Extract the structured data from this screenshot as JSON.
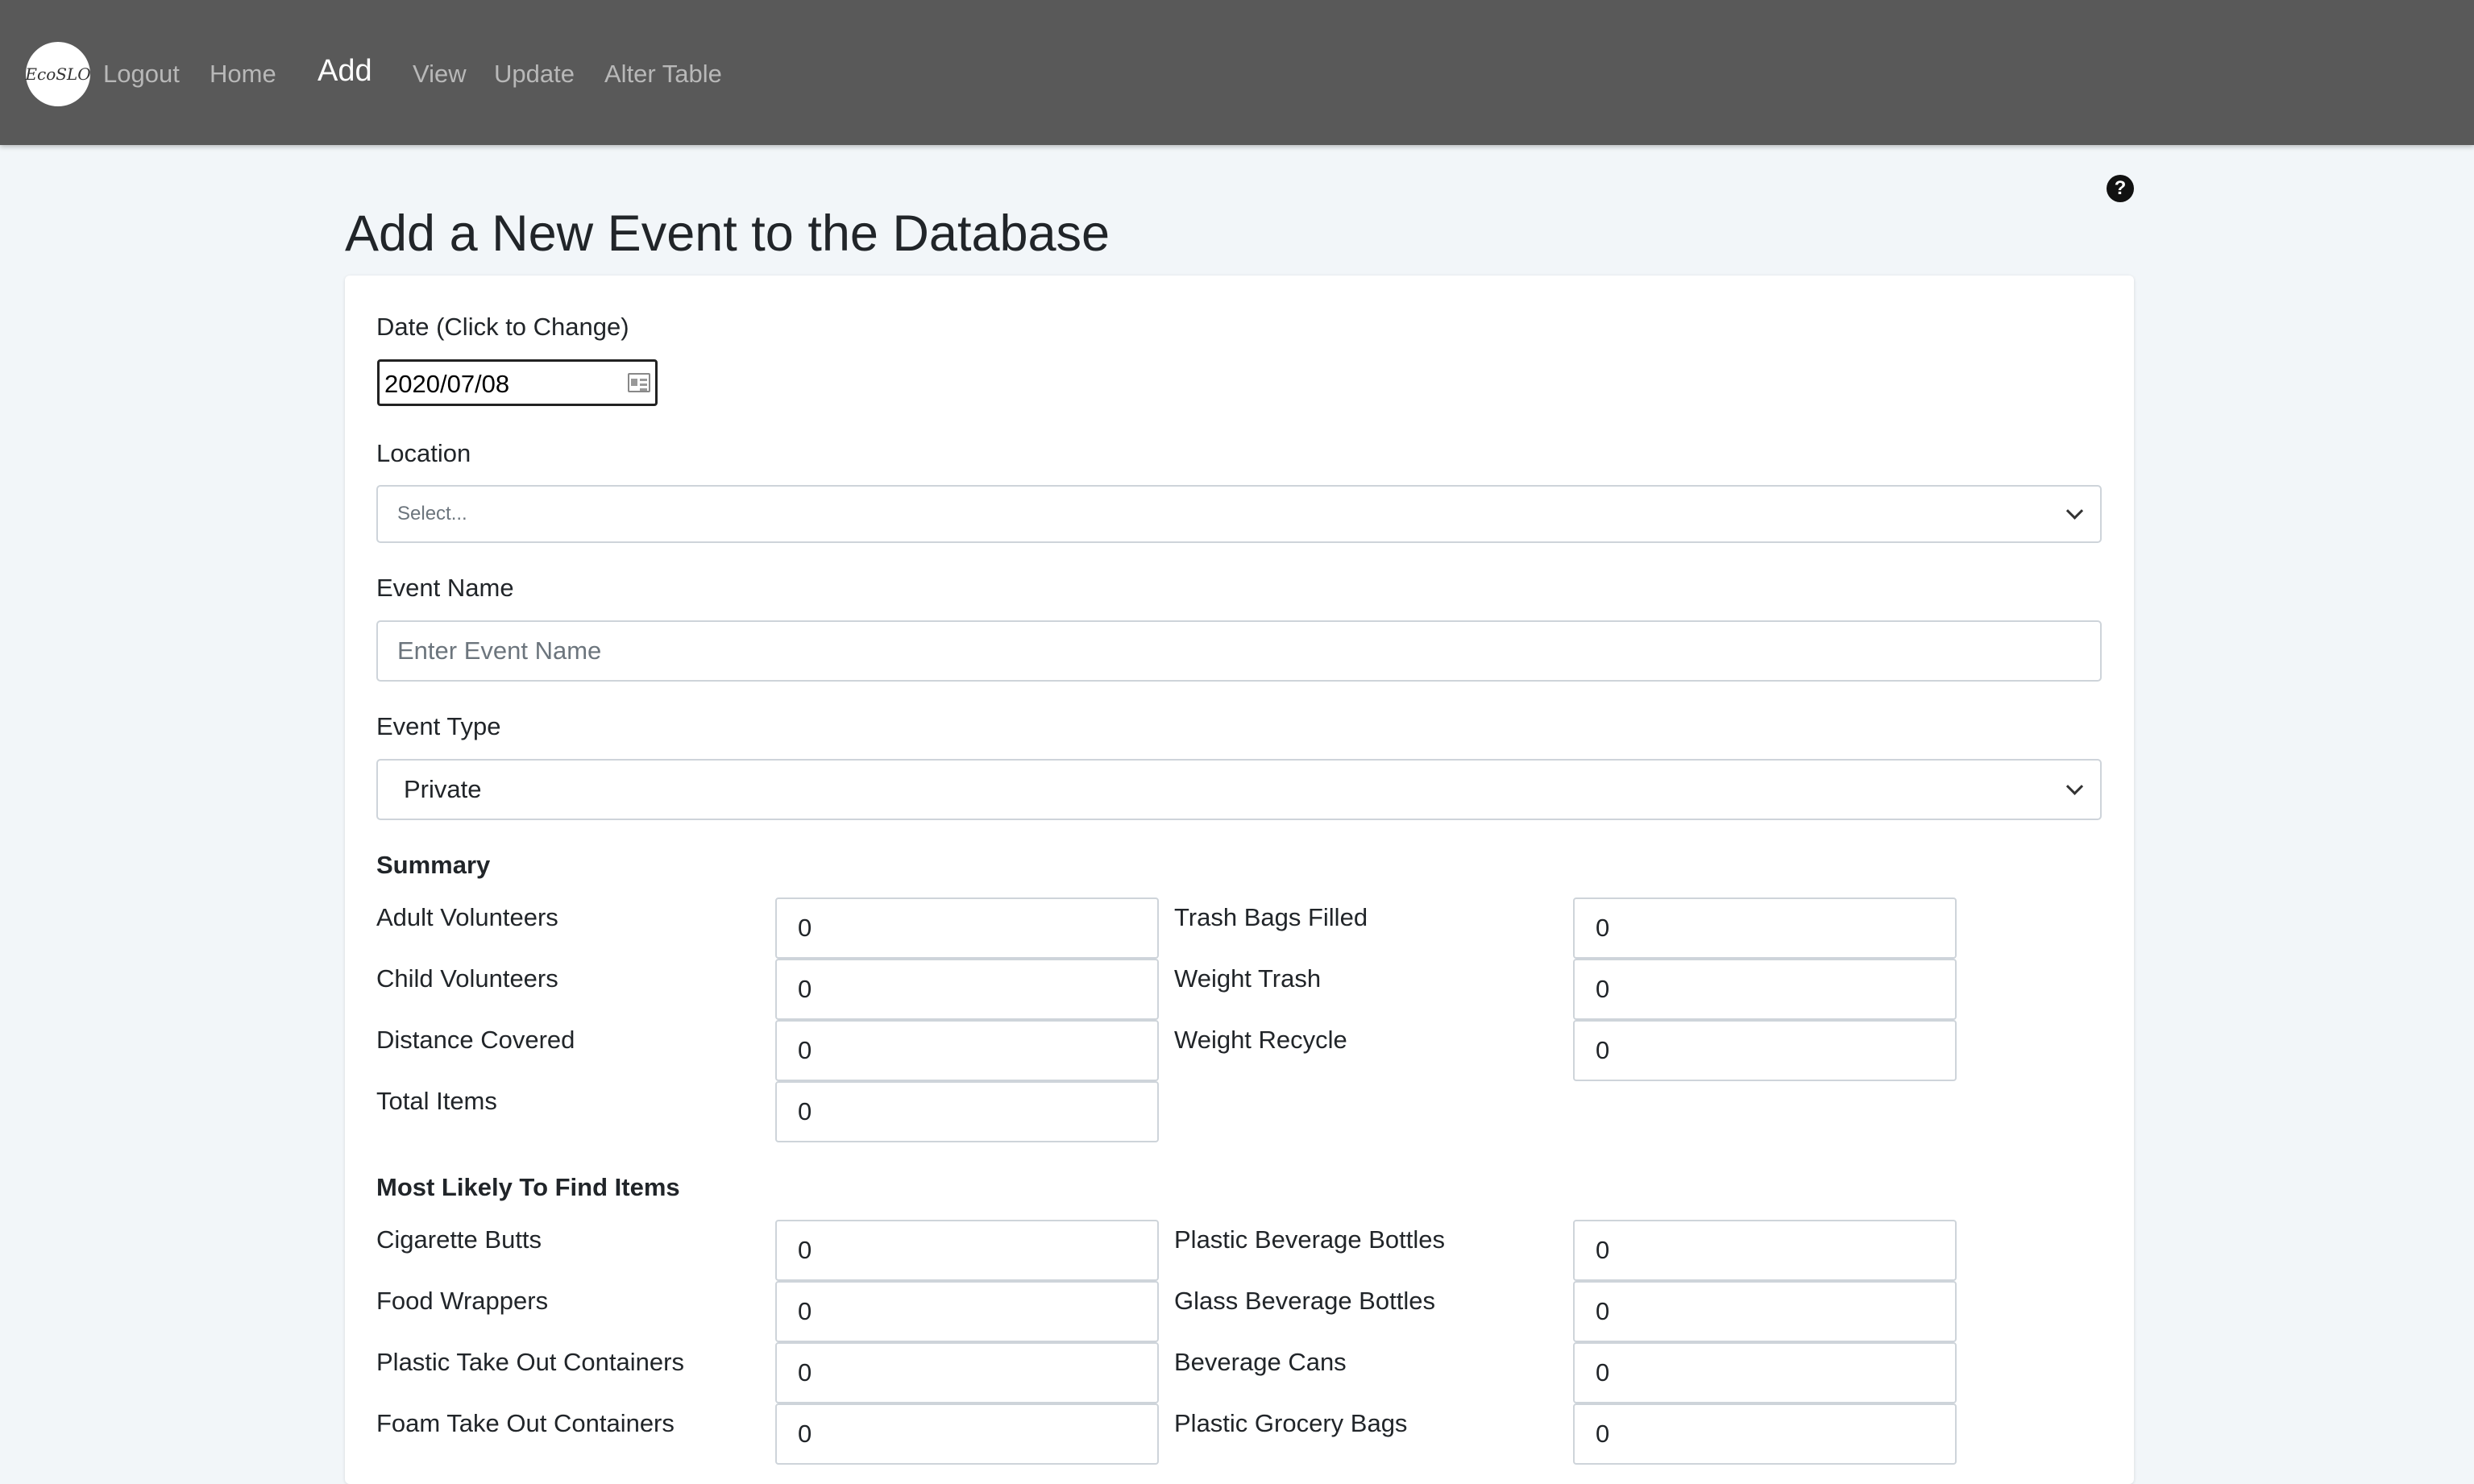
{
  "nav": {
    "logo_text": "EcoSLO",
    "items": [
      {
        "label": "Logout"
      },
      {
        "label": "Home"
      },
      {
        "label": "Add"
      },
      {
        "label": "View"
      },
      {
        "label": "Update"
      },
      {
        "label": "Alter Table"
      }
    ]
  },
  "help_icon": "question-circle-icon",
  "page_title": "Add a New Event to the Database",
  "form": {
    "date_label": "Date (Click to Change)",
    "date_value": "2020/07/08",
    "location_label": "Location",
    "location_placeholder": "Select...",
    "event_name_label": "Event Name",
    "event_name_placeholder": "Enter Event Name",
    "event_type_label": "Event Type",
    "event_type_value": "Private"
  },
  "summary": {
    "heading": "Summary",
    "left": [
      {
        "label": "Adult Volunteers",
        "value": "0"
      },
      {
        "label": "Child Volunteers",
        "value": "0"
      },
      {
        "label": "Distance Covered",
        "value": "0"
      },
      {
        "label": "Total Items",
        "value": "0"
      }
    ],
    "right": [
      {
        "label": "Trash Bags Filled",
        "value": "0"
      },
      {
        "label": "Weight Trash",
        "value": "0"
      },
      {
        "label": "Weight Recycle",
        "value": "0"
      }
    ]
  },
  "likely": {
    "heading": "Most Likely To Find Items",
    "left": [
      {
        "label": "Cigarette Butts",
        "value": "0"
      },
      {
        "label": "Food Wrappers",
        "value": "0"
      },
      {
        "label": "Plastic Take Out Containers",
        "value": "0"
      },
      {
        "label": "Foam Take Out Containers",
        "value": "0"
      }
    ],
    "right": [
      {
        "label": "Plastic Beverage Bottles",
        "value": "0"
      },
      {
        "label": "Glass Beverage Bottles",
        "value": "0"
      },
      {
        "label": "Beverage Cans",
        "value": "0"
      },
      {
        "label": "Plastic Grocery Bags",
        "value": "0"
      }
    ]
  }
}
